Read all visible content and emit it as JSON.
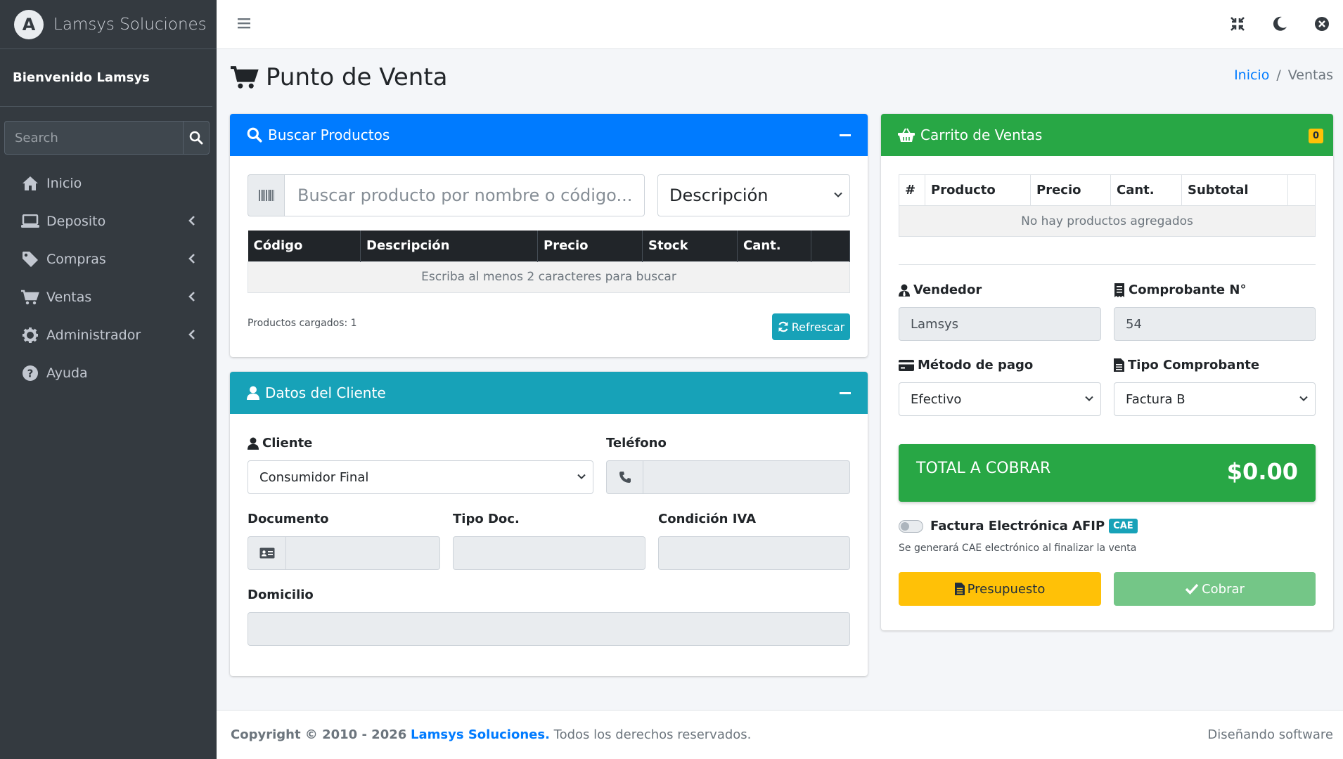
{
  "app": {
    "brand": "Lamsys Soluciones",
    "logo_letter": "A"
  },
  "sidebar": {
    "welcome": "Bienvenido Lamsys",
    "search_placeholder": "Search",
    "items": [
      {
        "label": "Inicio",
        "icon": "home-icon",
        "has_submenu": false
      },
      {
        "label": "Deposito",
        "icon": "laptop-icon",
        "has_submenu": true
      },
      {
        "label": "Compras",
        "icon": "tag-icon",
        "has_submenu": true
      },
      {
        "label": "Ventas",
        "icon": "cart-icon",
        "has_submenu": true
      },
      {
        "label": "Administrador",
        "icon": "gear-icon",
        "has_submenu": true
      },
      {
        "label": "Ayuda",
        "icon": "question-circle-icon",
        "has_submenu": false
      }
    ]
  },
  "page": {
    "title": "Punto de Venta",
    "breadcrumb": {
      "home": "Inicio",
      "current": "Ventas"
    }
  },
  "search_card": {
    "title": "Buscar Productos",
    "placeholder": "Buscar producto por nombre o código...",
    "filter_selected": "Descripción",
    "columns": [
      "Código",
      "Descripción",
      "Precio",
      "Stock",
      "Cant.",
      ""
    ],
    "empty_message": "Escriba al menos 2 caracteres para buscar",
    "loaded_text": "Productos cargados: 1",
    "refresh_label": "Refrescar"
  },
  "client_card": {
    "title": "Datos del Cliente",
    "cliente_label": "Cliente",
    "cliente_selected": "Consumidor Final",
    "telefono_label": "Teléfono",
    "telefono_value": "",
    "documento_label": "Documento",
    "documento_value": "",
    "tipo_doc_label": "Tipo Doc.",
    "tipo_doc_value": "",
    "condicion_iva_label": "Condición IVA",
    "condicion_iva_value": "",
    "domicilio_label": "Domicilio",
    "domicilio_value": ""
  },
  "cart_card": {
    "title": "Carrito de Ventas",
    "badge_count": "0",
    "columns": [
      "#",
      "Producto",
      "Precio",
      "Cant.",
      "Subtotal",
      ""
    ],
    "empty_message": "No hay productos agregados",
    "vendedor_label": "Vendedor",
    "vendedor_value": "Lamsys",
    "comprobante_label": "Comprobante N°",
    "comprobante_value": "54",
    "metodo_label": "Método de pago",
    "metodo_selected": "Efectivo",
    "tipo_comprobante_label": "Tipo Comprobante",
    "tipo_comprobante_selected": "Factura B",
    "total_label": "TOTAL A COBRAR",
    "total_value": "$0.00",
    "afip_label": "Factura Electrónica AFIP",
    "afip_badge": "CAE",
    "afip_enabled": false,
    "afip_note": "Se generará CAE electrónico al finalizar la venta",
    "presupuesto_label": "Presupuesto",
    "cobrar_label": "Cobrar"
  },
  "footer": {
    "copyright": "Copyright © 2010 - 2026",
    "company": "Lamsys Soluciones.",
    "rights": "Todos los derechos reservados.",
    "right_text": "Diseñando software"
  },
  "colors": {
    "primary": "#007bff",
    "info": "#17a2b8",
    "success": "#28a745",
    "warning": "#ffc107",
    "sidebar": "#343a40"
  }
}
